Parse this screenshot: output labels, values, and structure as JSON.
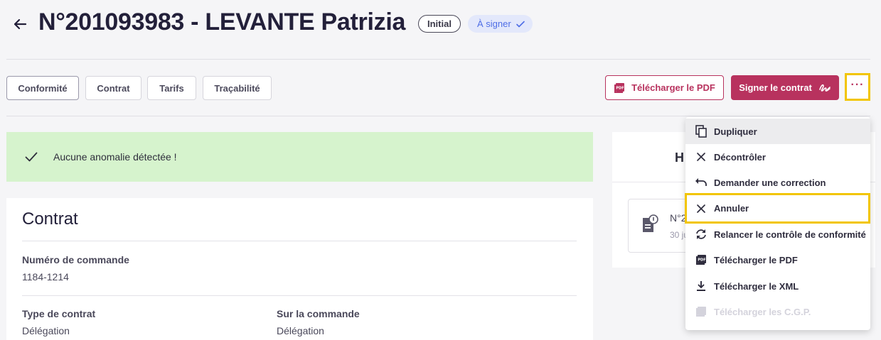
{
  "header": {
    "title": "N°201093983 - LEVANTE Patrizia",
    "badge_status": "Initial",
    "badge_signature": "À signer"
  },
  "tabs": [
    {
      "label": "Conformité",
      "active": true
    },
    {
      "label": "Contrat",
      "active": false
    },
    {
      "label": "Tarifs",
      "active": false
    },
    {
      "label": "Traçabilité",
      "active": false
    }
  ],
  "actions": {
    "download_pdf": "Télécharger le PDF",
    "sign_contract": "Signer le contrat",
    "more": "···"
  },
  "alert": {
    "text": "Aucune anomalie détectée !"
  },
  "contract": {
    "title": "Contrat",
    "order_number_label": "Numéro de commande",
    "order_number_value": "1184-1214",
    "contract_type_label": "Type de contrat",
    "contract_type_value": "Délégation",
    "on_order_label": "Sur la commande",
    "on_order_value": "Délégation"
  },
  "side_panel": {
    "title_partial": "H",
    "doc_number_partial": "N°2",
    "doc_date_partial": "30 ju"
  },
  "menu": {
    "items": [
      {
        "label": "Dupliquer",
        "icon": "copy-icon"
      },
      {
        "label": "Décontrôler",
        "icon": "close-icon"
      },
      {
        "label": "Demander une correction",
        "icon": "undo-icon"
      },
      {
        "label": "Annuler",
        "icon": "close-icon"
      },
      {
        "label": "Relancer le contrôle de conformité",
        "icon": "refresh-icon"
      },
      {
        "label": "Télécharger le PDF",
        "icon": "pdf-icon"
      },
      {
        "label": "Télécharger le XML",
        "icon": "download-icon"
      },
      {
        "label": "Télécharger les C.G.P.",
        "icon": "pdf-icon",
        "disabled": true
      }
    ]
  },
  "colors": {
    "brand": "#b8325e",
    "success_bg": "#d6f3cd",
    "badge_blue": "#4f6ee6",
    "highlight": "#f2c500"
  }
}
